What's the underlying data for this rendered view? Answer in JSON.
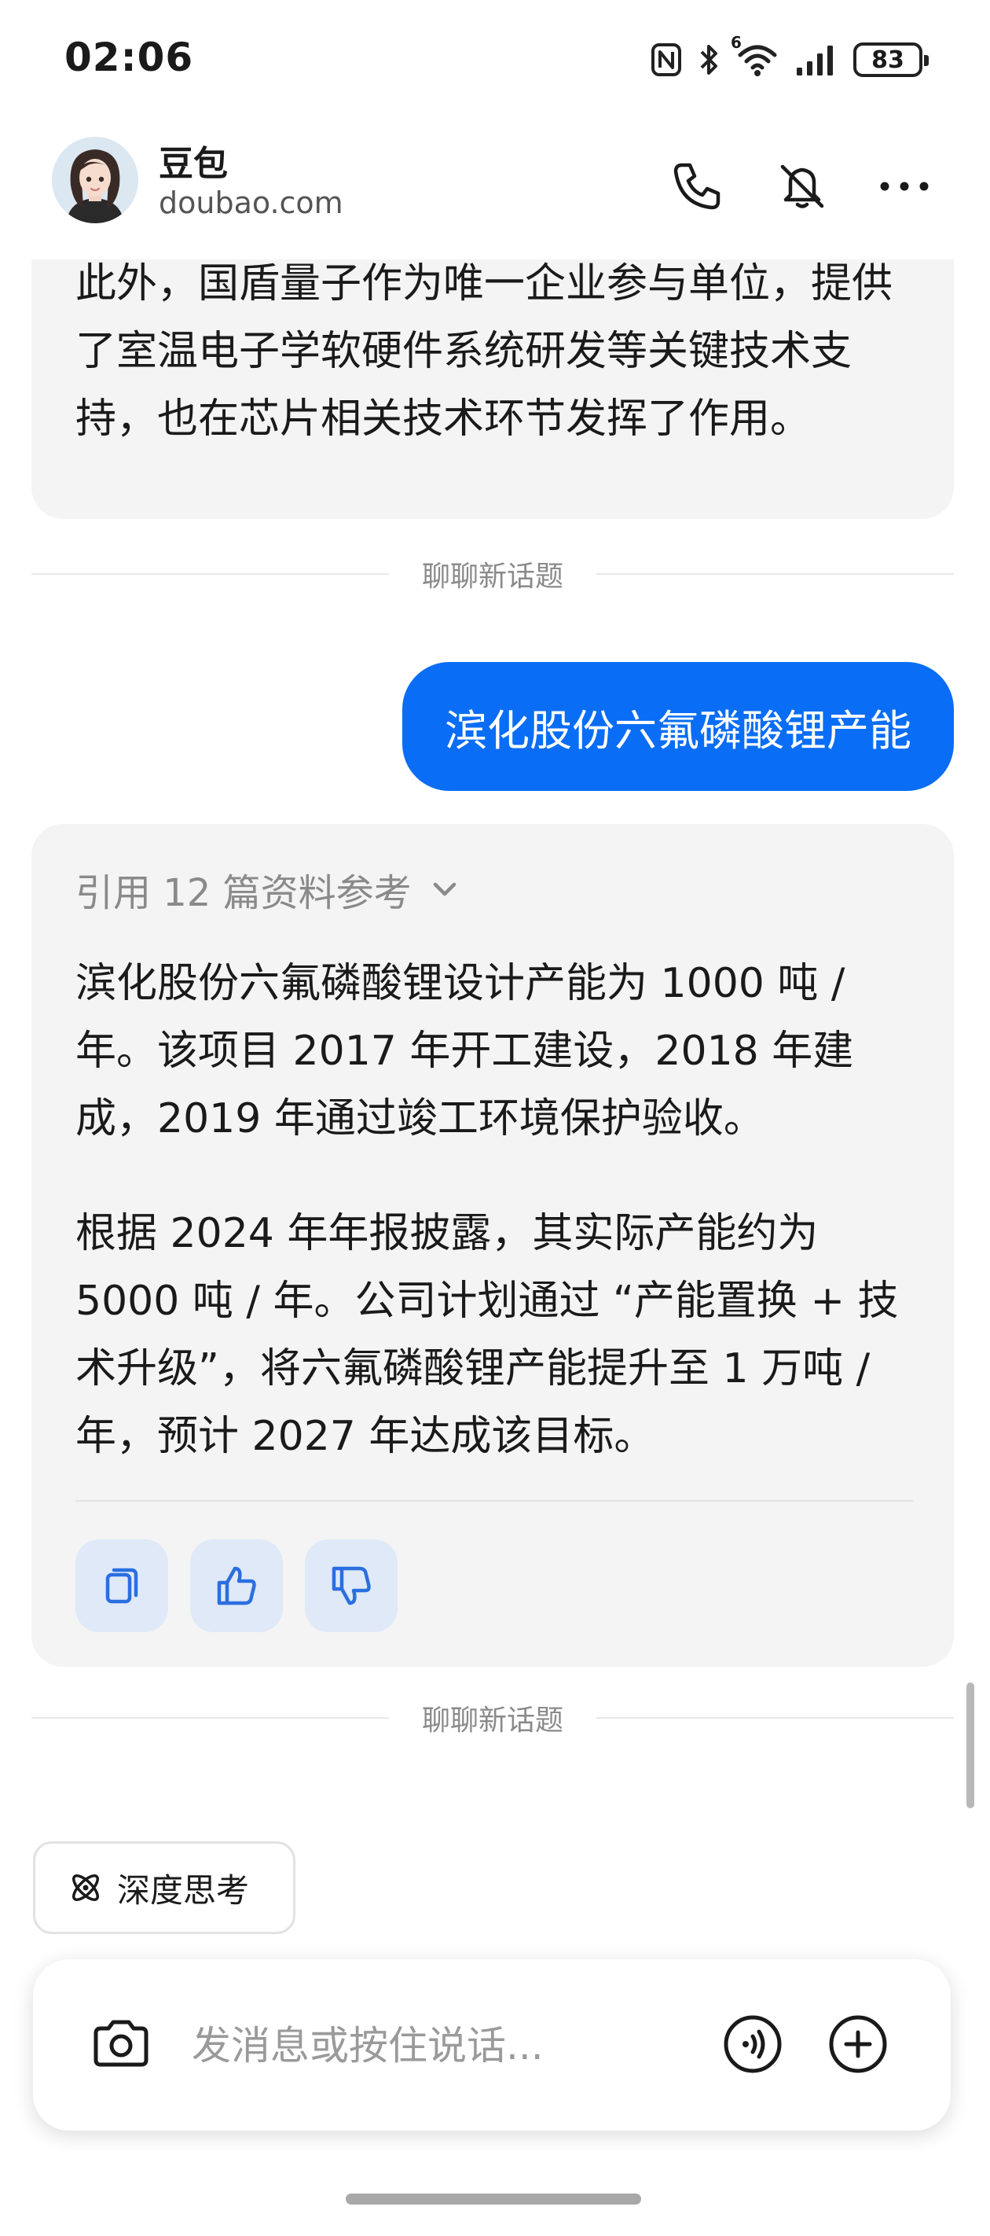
{
  "status_bar": {
    "time": "02:06",
    "battery": "83",
    "network_badge": "6",
    "icons": [
      "nfc-icon",
      "bluetooth-icon",
      "wifi-icon",
      "signal-icon",
      "battery-icon"
    ]
  },
  "header": {
    "title": "豆包",
    "subtitle": "doubao.com",
    "actions": [
      "phone-icon",
      "mute-icon",
      "more-icon"
    ]
  },
  "chat": {
    "previous_reply_tail": "此外，国盾量子作为唯一企业参与单位，提供了室温电子学软硬件系统研发等关键技术支持，也在芯片相关技术环节发挥了作用。",
    "divider_1": "聊聊新话题",
    "user_message": "滨化股份六氟磷酸锂产能",
    "reply": {
      "references": "引用 12 篇资料参考",
      "paragraph_1": "滨化股份六氟磷酸锂设计产能为 1000 吨 / 年。该项目 2017 年开工建设，2018 年建成，2019 年通过竣工环境保护验收。",
      "paragraph_2": "根据 2024 年年报披露，其实际产能约为 5000 吨 / 年。公司计划通过 “产能置换 + 技术升级”，将六氟磷酸锂产能提升至 1 万吨 / 年，预计 2027 年达成该目标。",
      "actions": [
        "copy-icon",
        "thumbs-up-icon",
        "thumbs-down-icon"
      ]
    },
    "divider_2": "聊聊新话题"
  },
  "composer": {
    "deep_think_label": "深度思考",
    "placeholder": "发消息或按住说话...",
    "value": ""
  },
  "colors": {
    "accent": "#0a6df5",
    "bubble_bg": "#f4f4f4",
    "action_bg": "#dfe9f8"
  }
}
